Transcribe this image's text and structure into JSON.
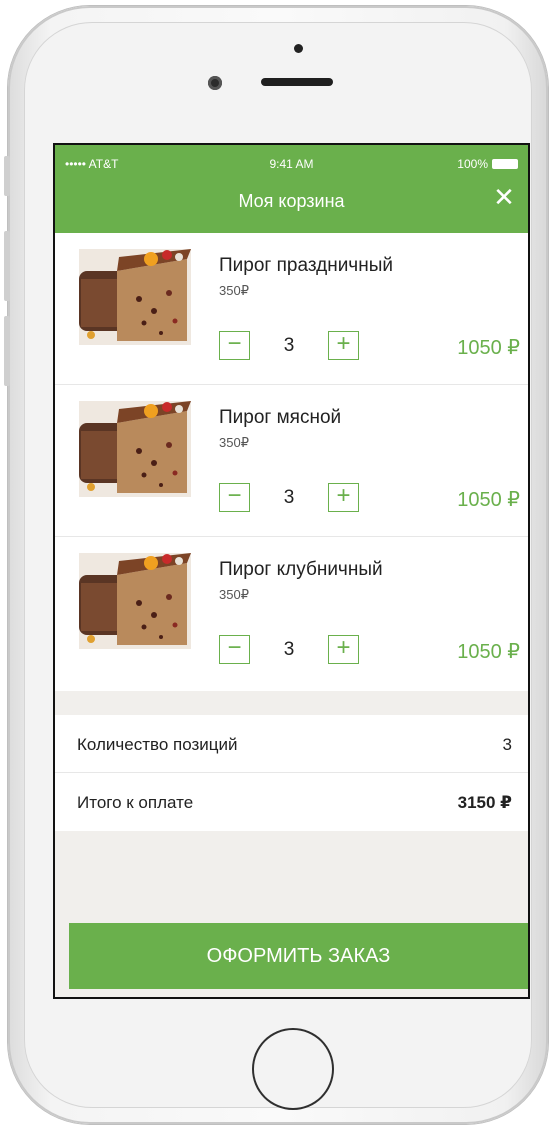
{
  "status_bar": {
    "carrier": "••••• AT&T",
    "time": "9:41 AM",
    "battery": "100%"
  },
  "header": {
    "title": "Моя корзина",
    "close_symbol": "✕"
  },
  "cart": {
    "items": [
      {
        "name": "Пирог праздничный",
        "unit_price": "350₽",
        "minus": "−",
        "quantity": "3",
        "plus": "+",
        "total": "1050 ₽"
      },
      {
        "name": "Пирог мясной",
        "unit_price": "350₽",
        "minus": "−",
        "quantity": "3",
        "plus": "+",
        "total": "1050 ₽"
      },
      {
        "name": "Пирог клубничный",
        "unit_price": "350₽",
        "minus": "−",
        "quantity": "3",
        "plus": "+",
        "total": "1050 ₽"
      }
    ]
  },
  "summary": {
    "positions_label": "Количество позиций",
    "positions_value": "3",
    "total_label": "Итого к оплате",
    "total_value": "3150 ₽"
  },
  "order_button": "ОФОРМИТЬ ЗАКАЗ",
  "colors": {
    "accent": "#6ab04c",
    "background": "#f1efec"
  }
}
